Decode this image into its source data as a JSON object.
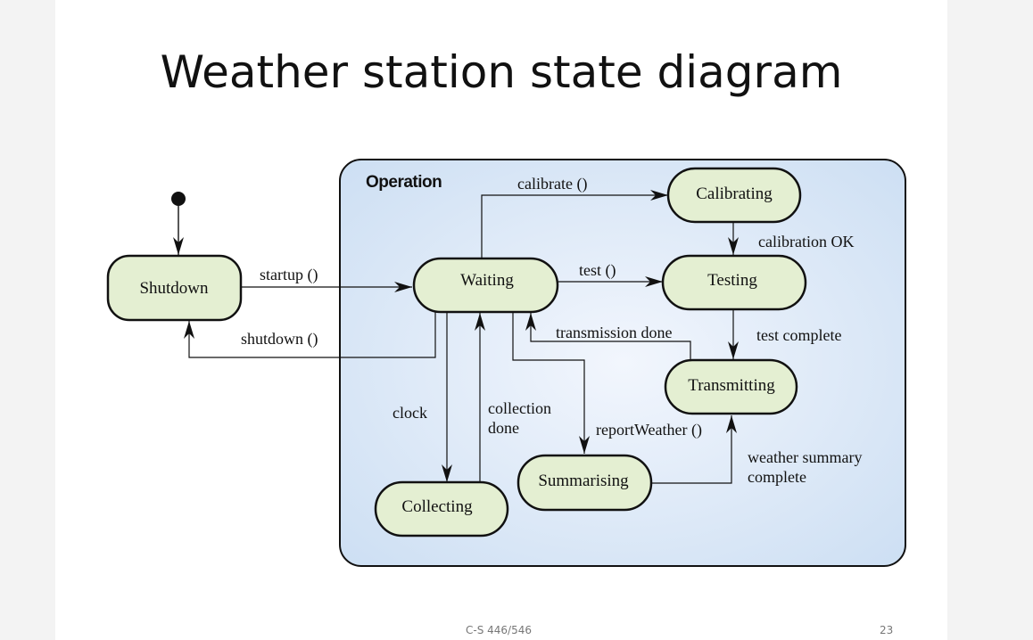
{
  "slide": {
    "title": "Weather station state diagram",
    "footer_course": "C-S 446/546",
    "page_number": "23"
  },
  "diagram": {
    "superstate_label": "Operation",
    "states": {
      "shutdown": "Shutdown",
      "waiting": "Waiting",
      "calibrating": "Calibrating",
      "testing": "Testing",
      "transmitting": "Transmitting",
      "summarising": "Summarising",
      "collecting": "Collecting"
    },
    "transitions": {
      "startup": "startup ()",
      "shutdown": "shutdown ()",
      "calibrate": "calibrate ()",
      "calibration_ok": "calibration OK",
      "test": "test ()",
      "transmission_done": "transmission done",
      "test_complete": "test complete",
      "clock": "clock",
      "collection_done_1": "collection",
      "collection_done_2": "done",
      "report_weather": "reportWeather ()",
      "weather_summary_1": "weather summary",
      "weather_summary_2": "complete"
    },
    "colors": {
      "state_fill": "#e4efd2",
      "superstate_fill_center": "#f2f6fd",
      "superstate_fill_edge": "#cddff3",
      "stroke": "#111111"
    }
  }
}
